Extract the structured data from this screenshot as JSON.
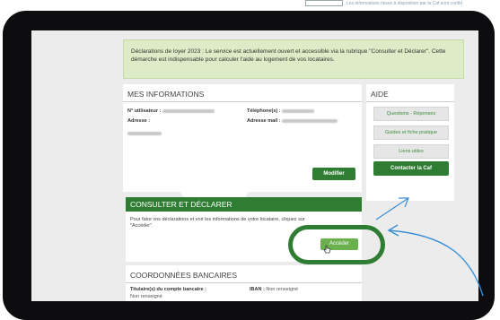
{
  "top_note": "Les informations mises à disposition par la Caf sont confid",
  "notice": "Déclarations de loyer 2023 : Le service est actuellement ouvert et accessible via la rubrique \"Consulter et Déclarer\". Cette démarche est indispensable pour calculer l'aide au logement de vos locataires.",
  "mes_infos": {
    "title": "MES INFORMATIONS",
    "user_label": "N° utilisateur :",
    "phone_label": "Téléphone(s) :",
    "address_label": "Adresse :",
    "email_label": "Adresse mail :",
    "modify_button": "Modifier"
  },
  "aide": {
    "title": "AIDE",
    "items": [
      "Questions - Réponses",
      "Guides et fiche pratique",
      "Liens utiles"
    ],
    "contact_button": "Contacter la Caf"
  },
  "consulter": {
    "title": "CONSULTER ET DÉCLARER",
    "text": "Pour faire vos déclarations et voir les informations de votre locataire, cliquez sur \"Accéder\".",
    "access_button": "Accéder"
  },
  "bancaires": {
    "title": "COORDONNÉES BANCAIRES",
    "holder_label": "Titulaire(s) du compte bancaire :",
    "holder_value": "Non renseigné",
    "iban_label": "IBAN :",
    "iban_value": "Non renseigné"
  },
  "colors": {
    "accent_green": "#2e7d32",
    "notice_bg": "#ddecc6",
    "arrow_blue": "#3a8ed8"
  }
}
